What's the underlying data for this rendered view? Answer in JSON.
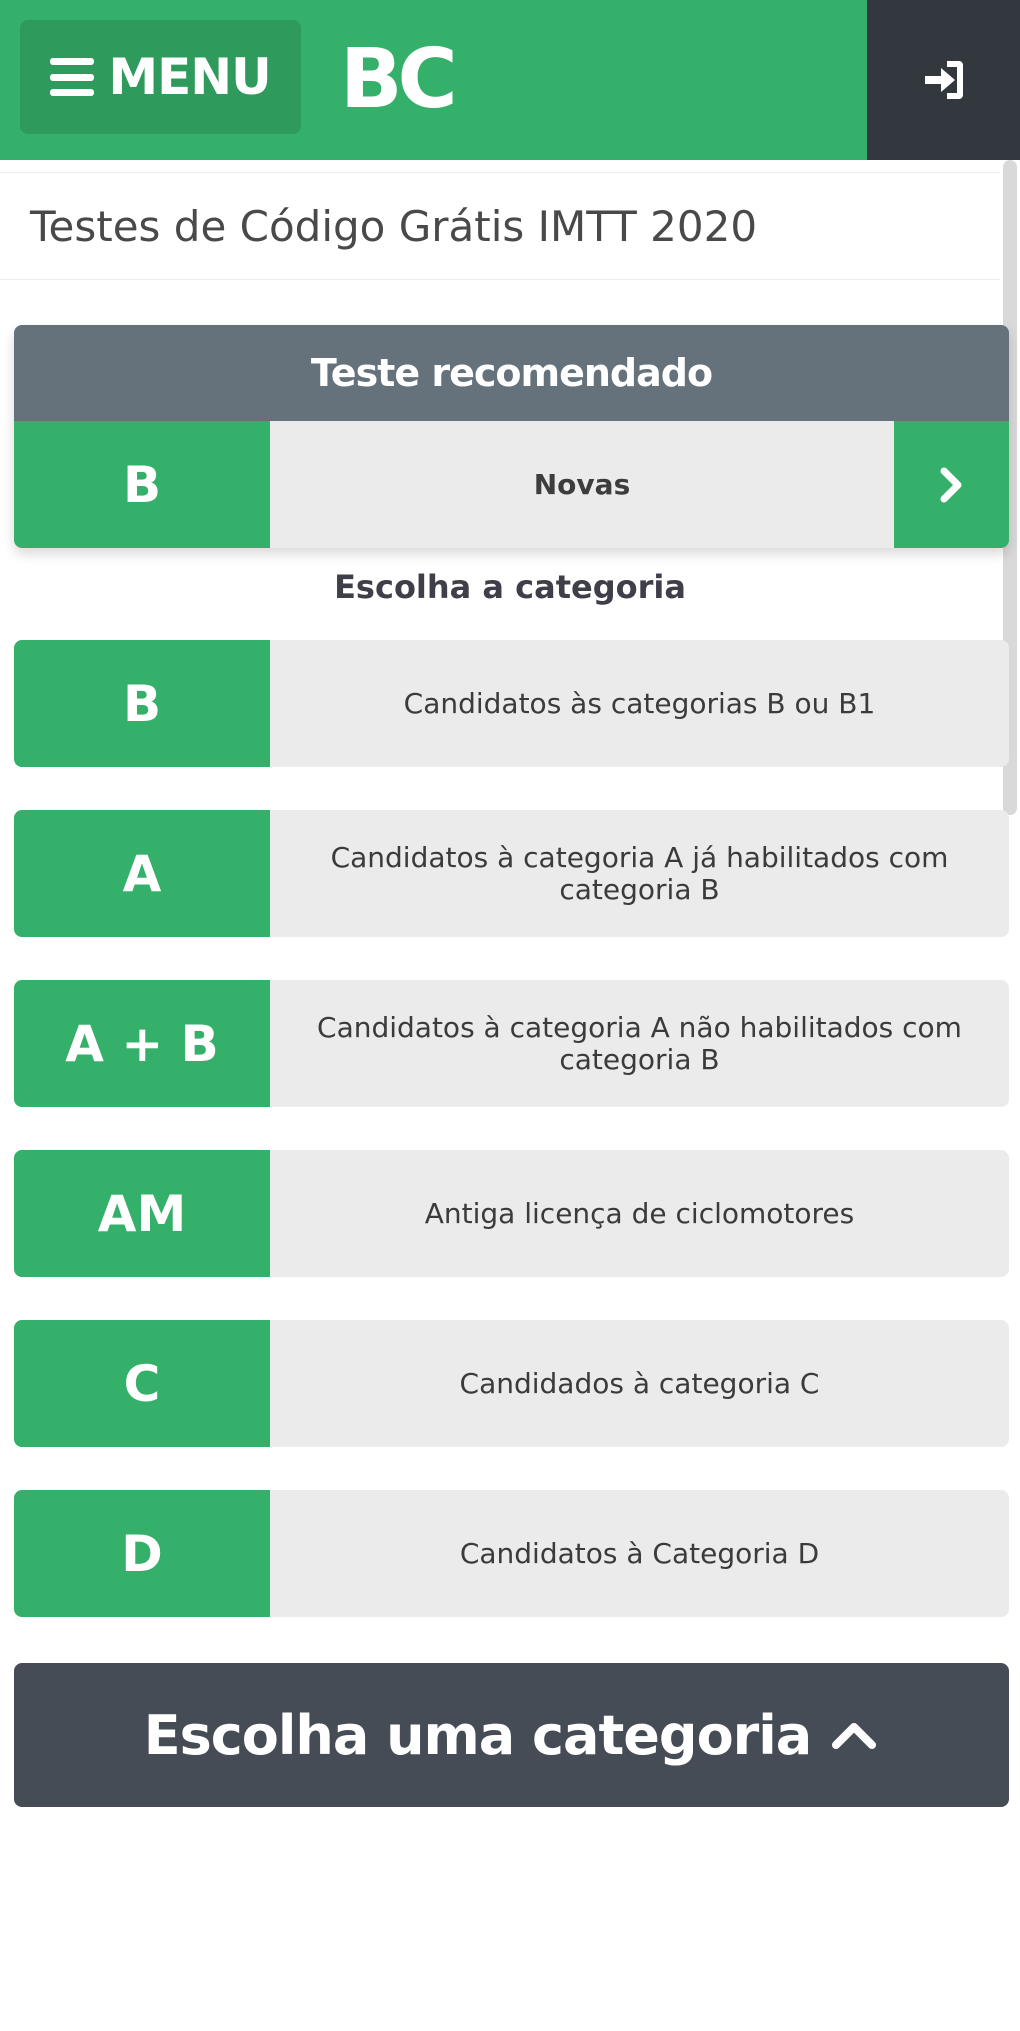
{
  "header": {
    "menu_label": "MENU",
    "logo_text": "BC",
    "login_icon": "sign-in-icon",
    "colors": {
      "brand_green": "#35b06a",
      "dark": "#33383f"
    }
  },
  "page": {
    "title": "Testes de Código Grátis IMTT 2020"
  },
  "recommended": {
    "heading": "Teste recomendado",
    "category": "B",
    "label": "Novas",
    "go_icon": "chevron-right-icon"
  },
  "categories": {
    "heading": "Escolha a categoria",
    "items": [
      {
        "code": "B",
        "description": "Candidatos às categorias B ou B1"
      },
      {
        "code": "A",
        "description": "Candidatos à categoria A já habilitados com categoria B"
      },
      {
        "code": "A + B",
        "description": "Candidatos à categoria A não habilitados com categoria B"
      },
      {
        "code": "AM",
        "description": "Antiga licença de ciclomotores"
      },
      {
        "code": "C",
        "description": "Candidados à categoria C"
      },
      {
        "code": "D",
        "description": "Candidatos à Categoria D"
      }
    ]
  },
  "footer_button": {
    "label": "Escolha uma categoria",
    "icon": "chevron-up-icon"
  }
}
